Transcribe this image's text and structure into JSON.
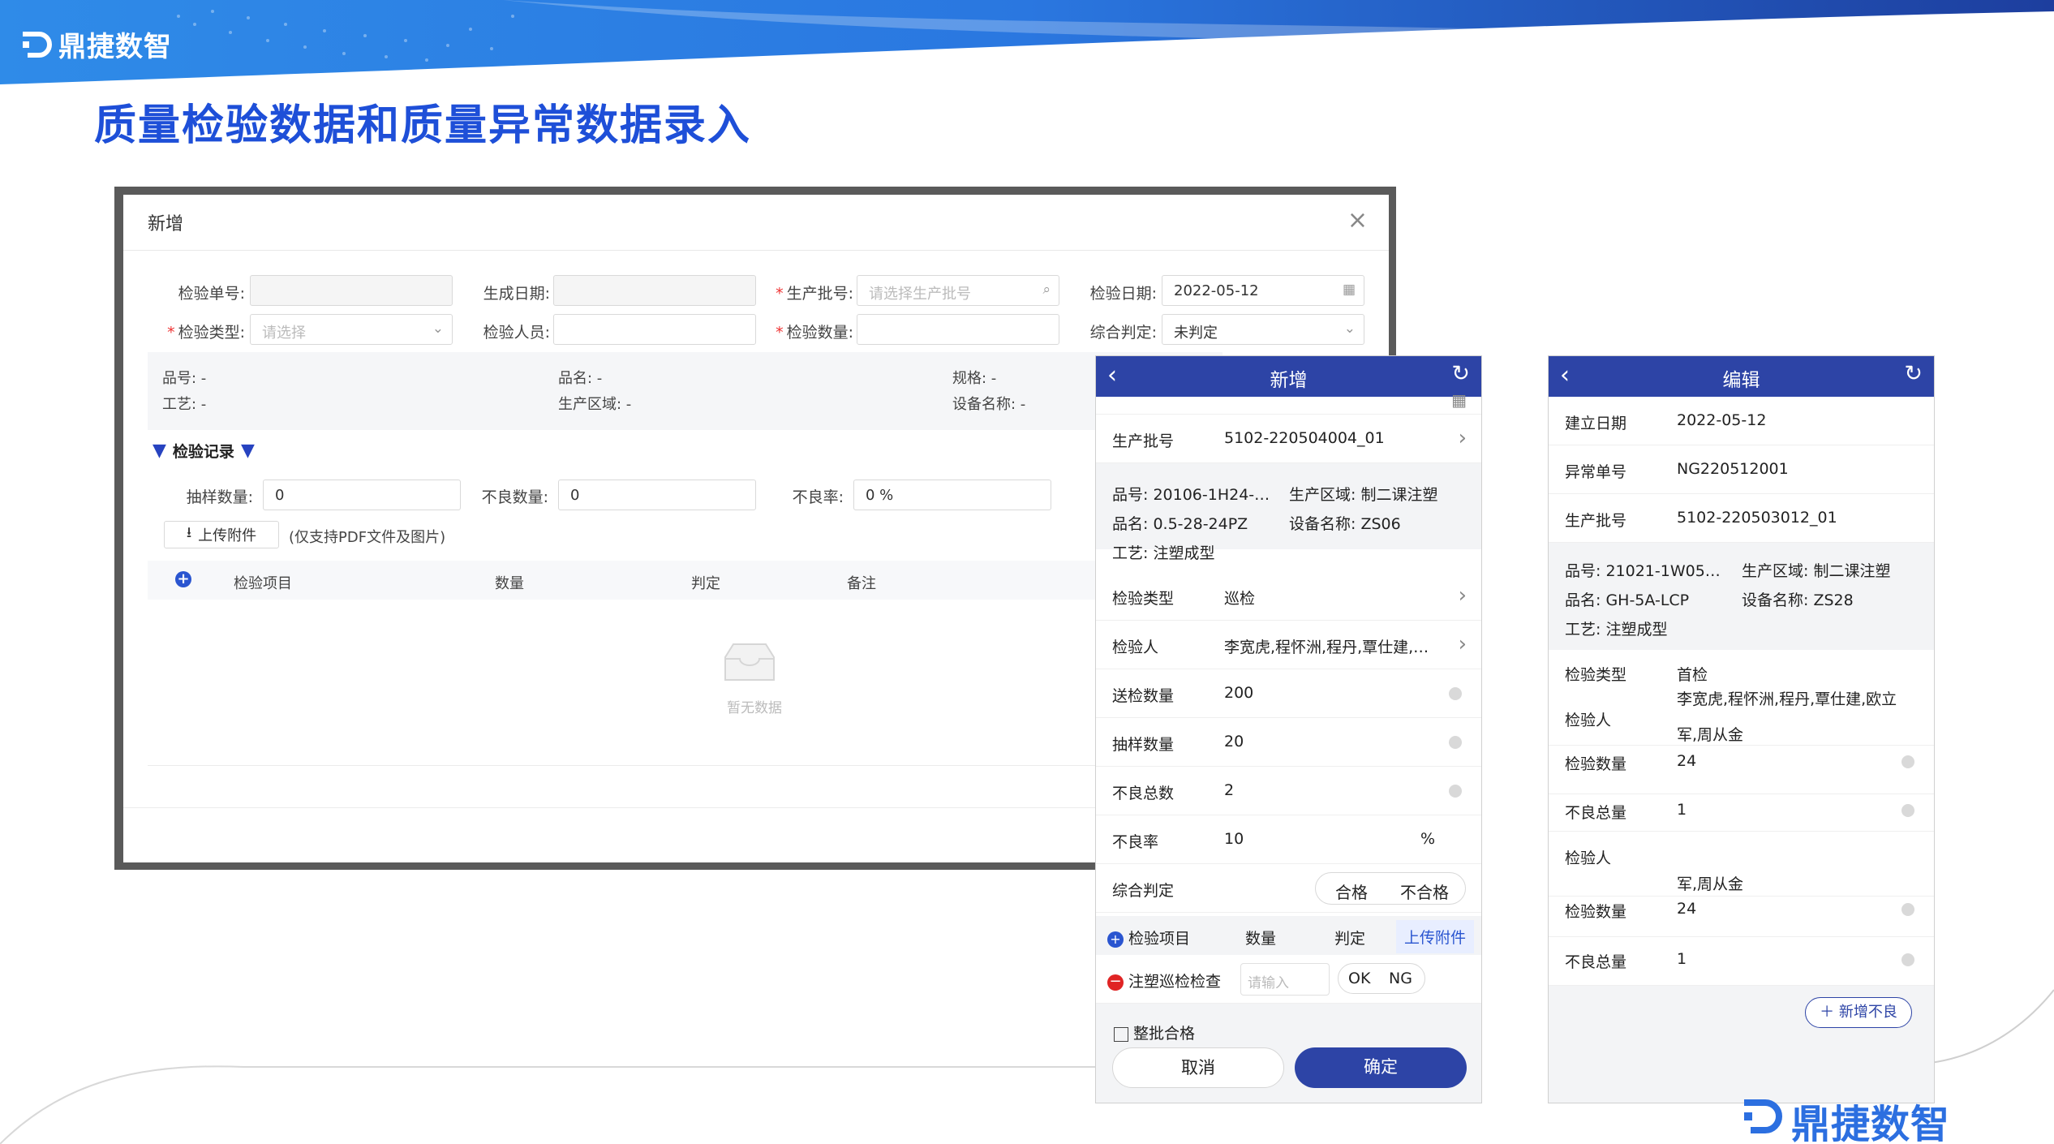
{
  "brand": {
    "name": "鼎捷数智"
  },
  "page_title": "质量检验数据和质量异常数据录入",
  "desktop": {
    "title": "新增",
    "close": "×",
    "fields": {
      "inspection_no": {
        "label": "检验单号:",
        "value": ""
      },
      "gen_date": {
        "label": "生成日期:",
        "value": ""
      },
      "batch_no": {
        "label": "生产批号:",
        "placeholder": "请选择生产批号"
      },
      "inspect_date": {
        "label": "检验日期:",
        "value": "2022-05-12"
      },
      "inspect_type": {
        "label": "检验类型:",
        "placeholder": "请选择"
      },
      "inspector": {
        "label": "检验人员:",
        "value": ""
      },
      "inspect_qty": {
        "label": "检验数量:",
        "value": ""
      },
      "judgement": {
        "label": "综合判定:",
        "value": "未判定"
      }
    },
    "info": {
      "part_no": "品号: -",
      "part_name": "品名: -",
      "spec": "规格: -",
      "process": "工艺: -",
      "area": "生产区域: -",
      "equipment": "设备名称: -"
    },
    "record_section": "检验记录",
    "sample_qty": {
      "label": "抽样数量:",
      "value": "0"
    },
    "defect_qty": {
      "label": "不良数量:",
      "value": "0"
    },
    "defect_rate": {
      "label": "不良率:",
      "value": "0 %"
    },
    "upload": {
      "label": "上传附件",
      "note": "(仅支持PDF文件及图片)"
    },
    "table_cols": [
      "检验项目",
      "数量",
      "判定",
      "备注"
    ],
    "empty_text": "暂无数据"
  },
  "mobile_new": {
    "title": "新增",
    "batch": {
      "label": "生产批号",
      "value": "5102-220504004_01"
    },
    "info": {
      "part_no": "品号:  20106-1H24-…",
      "area": "生产区域:  制二课注塑",
      "part_name": "品名:  0.5-28-24PZ",
      "equipment": "设备名称:  ZS06",
      "process": "工艺:  注塑成型"
    },
    "inspect_type": {
      "label": "检验类型",
      "value": "巡检"
    },
    "inspector": {
      "label": "检验人",
      "value": "李宽虎,程怀洲,程丹,覃仕建,…"
    },
    "submit_qty": {
      "label": "送检数量",
      "value": "200"
    },
    "sample_qty": {
      "label": "抽样数量",
      "value": "20"
    },
    "defect_total": {
      "label": "不良总数",
      "value": "2"
    },
    "defect_rate": {
      "label": "不良率",
      "value": "10",
      "unit": "%"
    },
    "judgement": {
      "label": "综合判定",
      "pass": "合格",
      "fail": "不合格"
    },
    "items_head": {
      "item": "检验项目",
      "qty": "数量",
      "judge": "判定",
      "upload": "上传附件"
    },
    "item_row": {
      "name": "注塑巡检检查",
      "placeholder": "请输入",
      "ok": "OK",
      "ng": "NG"
    },
    "whole_batch": "整批合格",
    "cancel": "取消",
    "confirm": "确定"
  },
  "mobile_edit": {
    "title": "编辑",
    "create_date": {
      "label": "建立日期",
      "value": "2022-05-12"
    },
    "abnormal_no": {
      "label": "异常单号",
      "value": "NG220512001"
    },
    "batch": {
      "label": "生产批号",
      "value": "5102-220503012_01"
    },
    "info": {
      "part_no": "品号:  21021-1W05…",
      "area": "生产区域:  制二课注塑",
      "part_name": "品名:  GH-5A-LCP",
      "equipment": "设备名称:  ZS28",
      "process": "工艺:  注塑成型"
    },
    "inspect_type": {
      "label": "检验类型",
      "value": "首检"
    },
    "inspector1": {
      "label": "检验人",
      "line1": "李宽虎,程怀洲,程丹,覃仕建,欧立",
      "line2": "军,周从金"
    },
    "inspect_qty1": {
      "label": "检验数量",
      "value": "24"
    },
    "defect1": {
      "label": "不良总量",
      "value": "1"
    },
    "inspector2": {
      "label": "检验人",
      "line2": "军,周从金"
    },
    "inspect_qty2": {
      "label": "检验数量",
      "value": "24"
    },
    "defect2": {
      "label": "不良总量",
      "value": "1"
    },
    "add_defect": "新增不良"
  },
  "colors": {
    "title_blue": "#1e4fd8",
    "header_blue": "#2d44a6",
    "accent_blue": "#2a55d0"
  }
}
